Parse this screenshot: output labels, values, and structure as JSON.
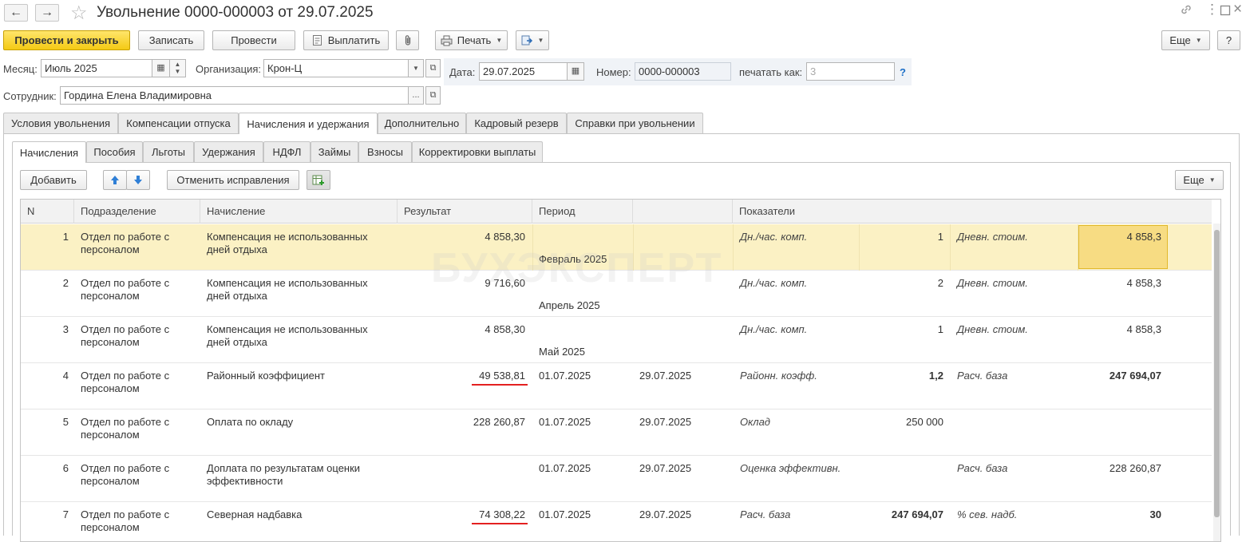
{
  "window": {
    "title": "Увольнение 0000-000003 от 29.07.2025",
    "back_icon": "arrow-left-icon",
    "forward_icon": "arrow-right-icon",
    "favorite_icon": "star-icon",
    "link_icon": "link-icon",
    "menu_icon": "more-vertical-icon",
    "maximize_icon": "maximize-icon",
    "close_icon": "close-icon"
  },
  "toolbar": {
    "post_close": "Провести и закрыть",
    "save": "Записать",
    "post": "Провести",
    "pay": "Выплатить",
    "print": "Печать",
    "more": "Еще",
    "help": "?"
  },
  "form": {
    "month_label": "Месяц:",
    "month_value": "Июль 2025",
    "org_label": "Организация:",
    "org_value": "Крон-Ц",
    "date_label": "Дата:",
    "date_value": "29.07.2025",
    "number_label": "Номер:",
    "number_value": "0000-000003",
    "print_as_label": "печатать как:",
    "print_as_placeholder": "3",
    "help_mark": "?",
    "employee_label": "Сотрудник:",
    "employee_value": "Гордина Елена Владимировна",
    "more_dots": "..."
  },
  "tabs": [
    "Условия увольнения",
    "Компенсации отпуска",
    "Начисления и удержания",
    "Дополнительно",
    "Кадровый резерв",
    "Справки при увольнении"
  ],
  "subtabs": [
    "Начисления",
    "Пособия",
    "Льготы",
    "Удержания",
    "НДФЛ",
    "Займы",
    "Взносы",
    "Корректировки выплаты"
  ],
  "table_toolbar": {
    "add": "Добавить",
    "cancel_corrections": "Отменить исправления",
    "more": "Еще"
  },
  "table": {
    "headers": [
      "N",
      "Подразделение",
      "Начисление",
      "Результат",
      "Период",
      "",
      "Показатели"
    ],
    "rows": [
      {
        "n": "1",
        "dept1": "Отдел по работе с",
        "dept2": "персоналом",
        "acc1": "Компенсация не использованных",
        "acc2": "дней отдыха",
        "result": "4 858,30",
        "period": "",
        "period2": "Февраль 2025",
        "period_end": "",
        "ind1_name": "Дн./час. комп.",
        "ind1_val": "1",
        "ind2_name": "Дневн. стоим.",
        "ind2_val": "4 858,3"
      },
      {
        "n": "2",
        "dept1": "Отдел по работе с",
        "dept2": "персоналом",
        "acc1": "Компенсация не использованных",
        "acc2": "дней отдыха",
        "result": "9 716,60",
        "period": "",
        "period2": "Апрель 2025",
        "period_end": "",
        "ind1_name": "Дн./час. комп.",
        "ind1_val": "2",
        "ind2_name": "Дневн. стоим.",
        "ind2_val": "4 858,3"
      },
      {
        "n": "3",
        "dept1": "Отдел по работе с",
        "dept2": "персоналом",
        "acc1": "Компенсация не использованных",
        "acc2": "дней отдыха",
        "result": "4 858,30",
        "period": "",
        "period2": "Май 2025",
        "period_end": "",
        "ind1_name": "Дн./час. комп.",
        "ind1_val": "1",
        "ind2_name": "Дневн. стоим.",
        "ind2_val": "4 858,3"
      },
      {
        "n": "4",
        "dept1": "Отдел по работе с",
        "dept2": "персоналом",
        "acc1": "Районный коэффициент",
        "acc2": "",
        "result": "49 538,81",
        "period": "01.07.2025",
        "period2": "",
        "period_end": "29.07.2025",
        "ind1_name": "Районн. коэфф.",
        "ind1_val": "1,2",
        "ind2_name": "Расч. база",
        "ind2_val": "247 694,07"
      },
      {
        "n": "5",
        "dept1": "Отдел по работе с",
        "dept2": "персоналом",
        "acc1": "Оплата по окладу",
        "acc2": "",
        "result": "228 260,87",
        "period": "01.07.2025",
        "period2": "",
        "period_end": "29.07.2025",
        "ind1_name": "Оклад",
        "ind1_val": "250 000",
        "ind2_name": "",
        "ind2_val": ""
      },
      {
        "n": "6",
        "dept1": "Отдел по работе с",
        "dept2": "персоналом",
        "acc1": "Доплата по результатам оценки",
        "acc2": "эффективности",
        "result": "",
        "period": "01.07.2025",
        "period2": "",
        "period_end": "29.07.2025",
        "ind1_name": "Оценка эффективн.",
        "ind1_val": "",
        "ind2_name": "Расч. база",
        "ind2_val": "228 260,87"
      },
      {
        "n": "7",
        "dept1": "Отдел по работе с",
        "dept2": "персоналом",
        "acc1": "Северная надбавка",
        "acc2": "",
        "result": "74 308,22",
        "period": "01.07.2025",
        "period2": "",
        "period_end": "29.07.2025",
        "ind1_name": "Расч. база",
        "ind1_val": "247 694,07",
        "ind2_name": "% сев. надб.",
        "ind2_val": "30"
      }
    ]
  },
  "watermark": "БУХЭКСПЕРТ",
  "colors": {
    "primary_button": "#f4ca14",
    "selected_row": "#fbf1c4",
    "selected_cell": "#f7dc83",
    "underline": "#e32020"
  }
}
